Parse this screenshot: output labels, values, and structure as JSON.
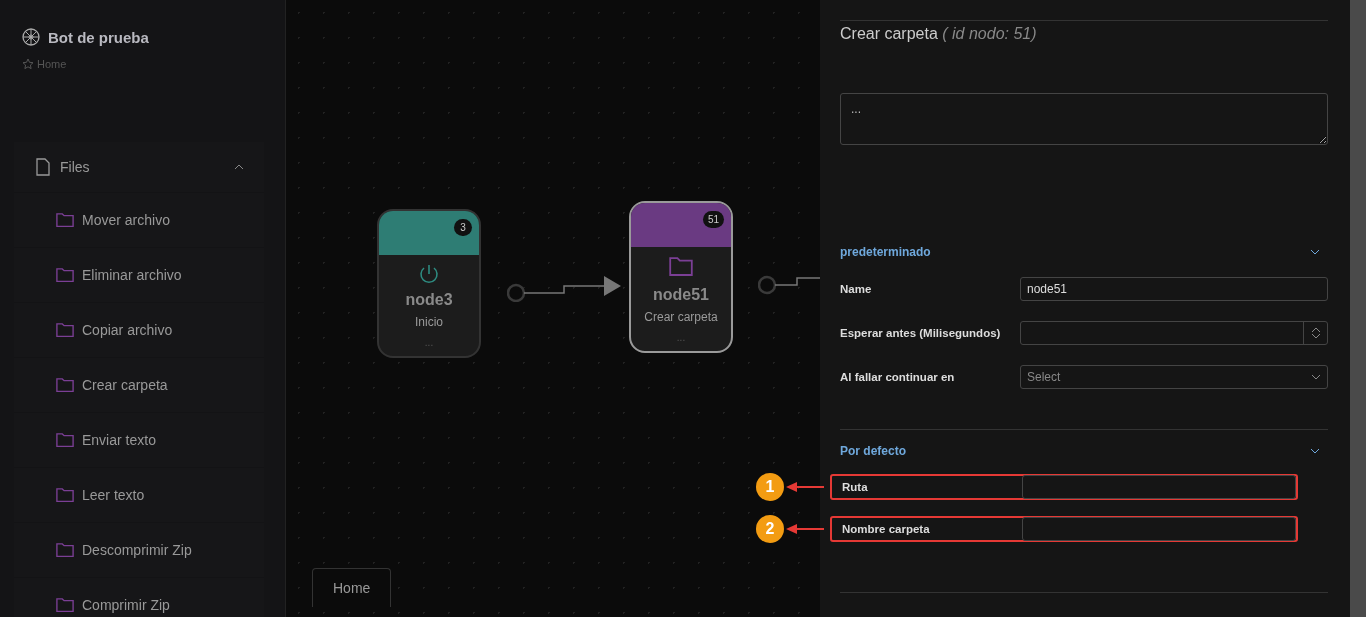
{
  "sidebar": {
    "title": "Bot de prueba",
    "breadcrumb": "Home",
    "group": {
      "label": "Files",
      "expanded": true,
      "items": [
        "Mover archivo",
        "Eliminar archivo",
        "Copiar archivo",
        "Crear carpeta",
        "Enviar texto",
        "Leer texto",
        "Descomprimir Zip",
        "Comprimir Zip"
      ]
    }
  },
  "canvas": {
    "nodes": [
      {
        "kind": "start",
        "name": "node3",
        "subtitle": "Inicio",
        "badge": "3",
        "footer": "...",
        "color": "#2e7d74",
        "selected": false
      },
      {
        "kind": "folder",
        "name": "node51",
        "subtitle": "Crear carpeta",
        "badge": "51",
        "footer": "...",
        "color": "#6a3a82",
        "selected": true
      }
    ],
    "tab": "Home"
  },
  "panel": {
    "title": "Crear carpeta",
    "id_note": "( id nodo: 51)",
    "description": "...",
    "sections": [
      {
        "title": "predeterminado",
        "expanded": true,
        "fields": [
          {
            "kind": "text",
            "label": "Name",
            "value": "node51"
          },
          {
            "kind": "number",
            "label": "Esperar antes (Milisegundos)"
          },
          {
            "kind": "select",
            "label": "Al fallar continuar en",
            "placeholder": "Select"
          }
        ]
      },
      {
        "title": "Por defecto",
        "expanded": true,
        "fields": [
          {
            "kind": "text",
            "label": "Ruta",
            "callout": "1"
          },
          {
            "kind": "text",
            "label": "Nombre carpeta",
            "callout": "2"
          }
        ]
      }
    ]
  }
}
